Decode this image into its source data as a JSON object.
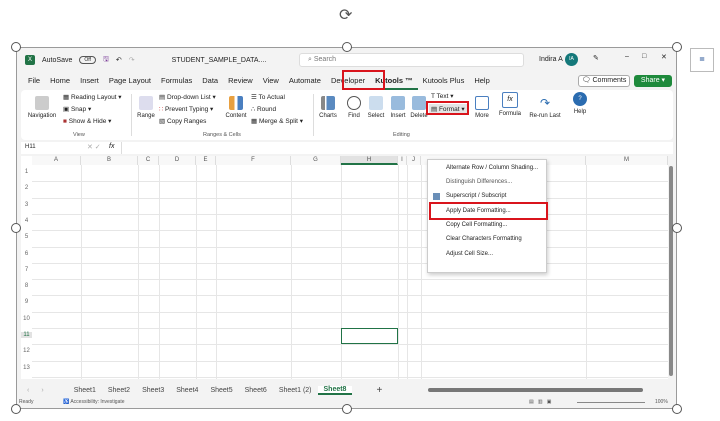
{
  "title_bar": {
    "autosave": "AutoSave",
    "toggle": "Off",
    "filename": "STUDENT_SAMPLE_DATA....",
    "search_placeholder": "Search",
    "user": "Indira A",
    "avatar": "IA"
  },
  "menu": [
    "File",
    "Home",
    "Insert",
    "Page Layout",
    "Formulas",
    "Data",
    "Review",
    "View",
    "Automate",
    "Developer",
    "Kutools ™",
    "Kutools Plus",
    "Help"
  ],
  "active_menu": "Kutools ™",
  "actions": {
    "comments": "Comments",
    "share": "Share"
  },
  "ribbon": {
    "view_group": {
      "label": "View",
      "navigation": "Navigation",
      "reading_layout": "Reading Layout",
      "snap": "Snap",
      "show_hide": "Show & Hide"
    },
    "ranges_group": {
      "label": "Ranges & Cells",
      "range": "Range",
      "dropdown_list": "Drop-down List",
      "prevent_typing": "Prevent Typing",
      "copy_ranges": "Copy Ranges",
      "content": "Content",
      "to_actual": "To Actual",
      "round": "Round",
      "merge_split": "Merge & Split"
    },
    "editing_group": {
      "label": "Editing",
      "charts": "Charts",
      "find": "Find",
      "select": "Select",
      "insert": "Insert",
      "delete": "Delete",
      "text": "Text",
      "format": "Format",
      "more": "More"
    },
    "formula": "Formula",
    "rerun": "Re-run Last",
    "help": "Help"
  },
  "formula_bar": {
    "name_box": "H11",
    "fx": "fx"
  },
  "columns": [
    "A",
    "B",
    "C",
    "D",
    "E",
    "F",
    "G",
    "H",
    "I",
    "J",
    "M"
  ],
  "rows": [
    "1",
    "2",
    "3",
    "4",
    "5",
    "6",
    "7",
    "8",
    "9",
    "10",
    "11",
    "12",
    "13"
  ],
  "format_menu": [
    "Alternate Row / Column Shading...",
    "Distinguish Differences...",
    "Superscript / Subscript",
    "Apply Date Formatting...",
    "Copy Cell Formatting...",
    "Clear Characters Formatting",
    "Adjust Cell Size..."
  ],
  "highlighted_menu_item": "Adjust Cell Size...",
  "sheets": [
    "Sheet1",
    "Sheet2",
    "Sheet3",
    "Sheet4",
    "Sheet5",
    "Sheet6",
    "Sheet1 (2)",
    "Sheet8"
  ],
  "active_sheet": "Sheet8",
  "status": {
    "ready": "Ready",
    "accessibility": "Accessibility: Investigate",
    "zoom": "100%"
  },
  "colors": {
    "excel_green": "#217346",
    "highlight_red": "#d9141c",
    "share_green": "#1e8a3c"
  }
}
